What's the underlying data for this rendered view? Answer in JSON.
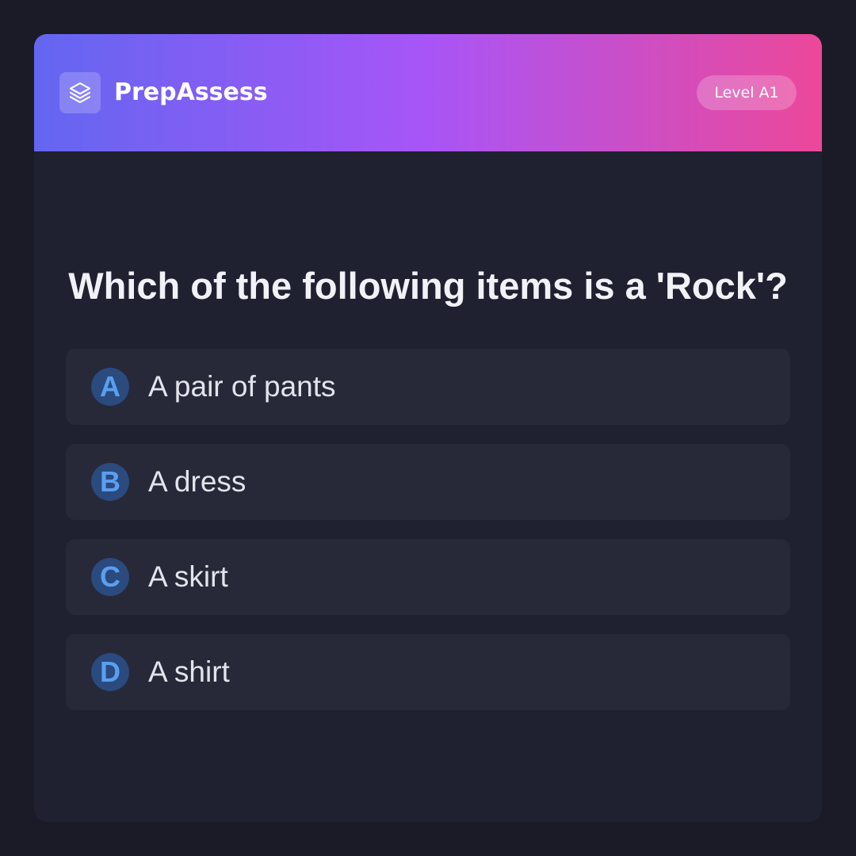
{
  "app": {
    "brand_name": "PrepAssess",
    "logo_icon": "layers-icon",
    "level_label": "Level A1"
  },
  "quiz": {
    "question": "Which of the following items is a 'Rock'?",
    "options": [
      {
        "letter": "A",
        "text": "A pair of pants"
      },
      {
        "letter": "B",
        "text": "A dress"
      },
      {
        "letter": "C",
        "text": "A skirt"
      },
      {
        "letter": "D",
        "text": "A shirt"
      }
    ]
  },
  "colors": {
    "background": "#1a1b26",
    "card": "#1f2130",
    "option_background": "#272938",
    "gradient_start": "#6366f1",
    "gradient_mid": "#a855f7",
    "gradient_end": "#ec4899",
    "option_badge_background": "#2b4a7e",
    "option_badge_text": "#5a9ff0"
  }
}
